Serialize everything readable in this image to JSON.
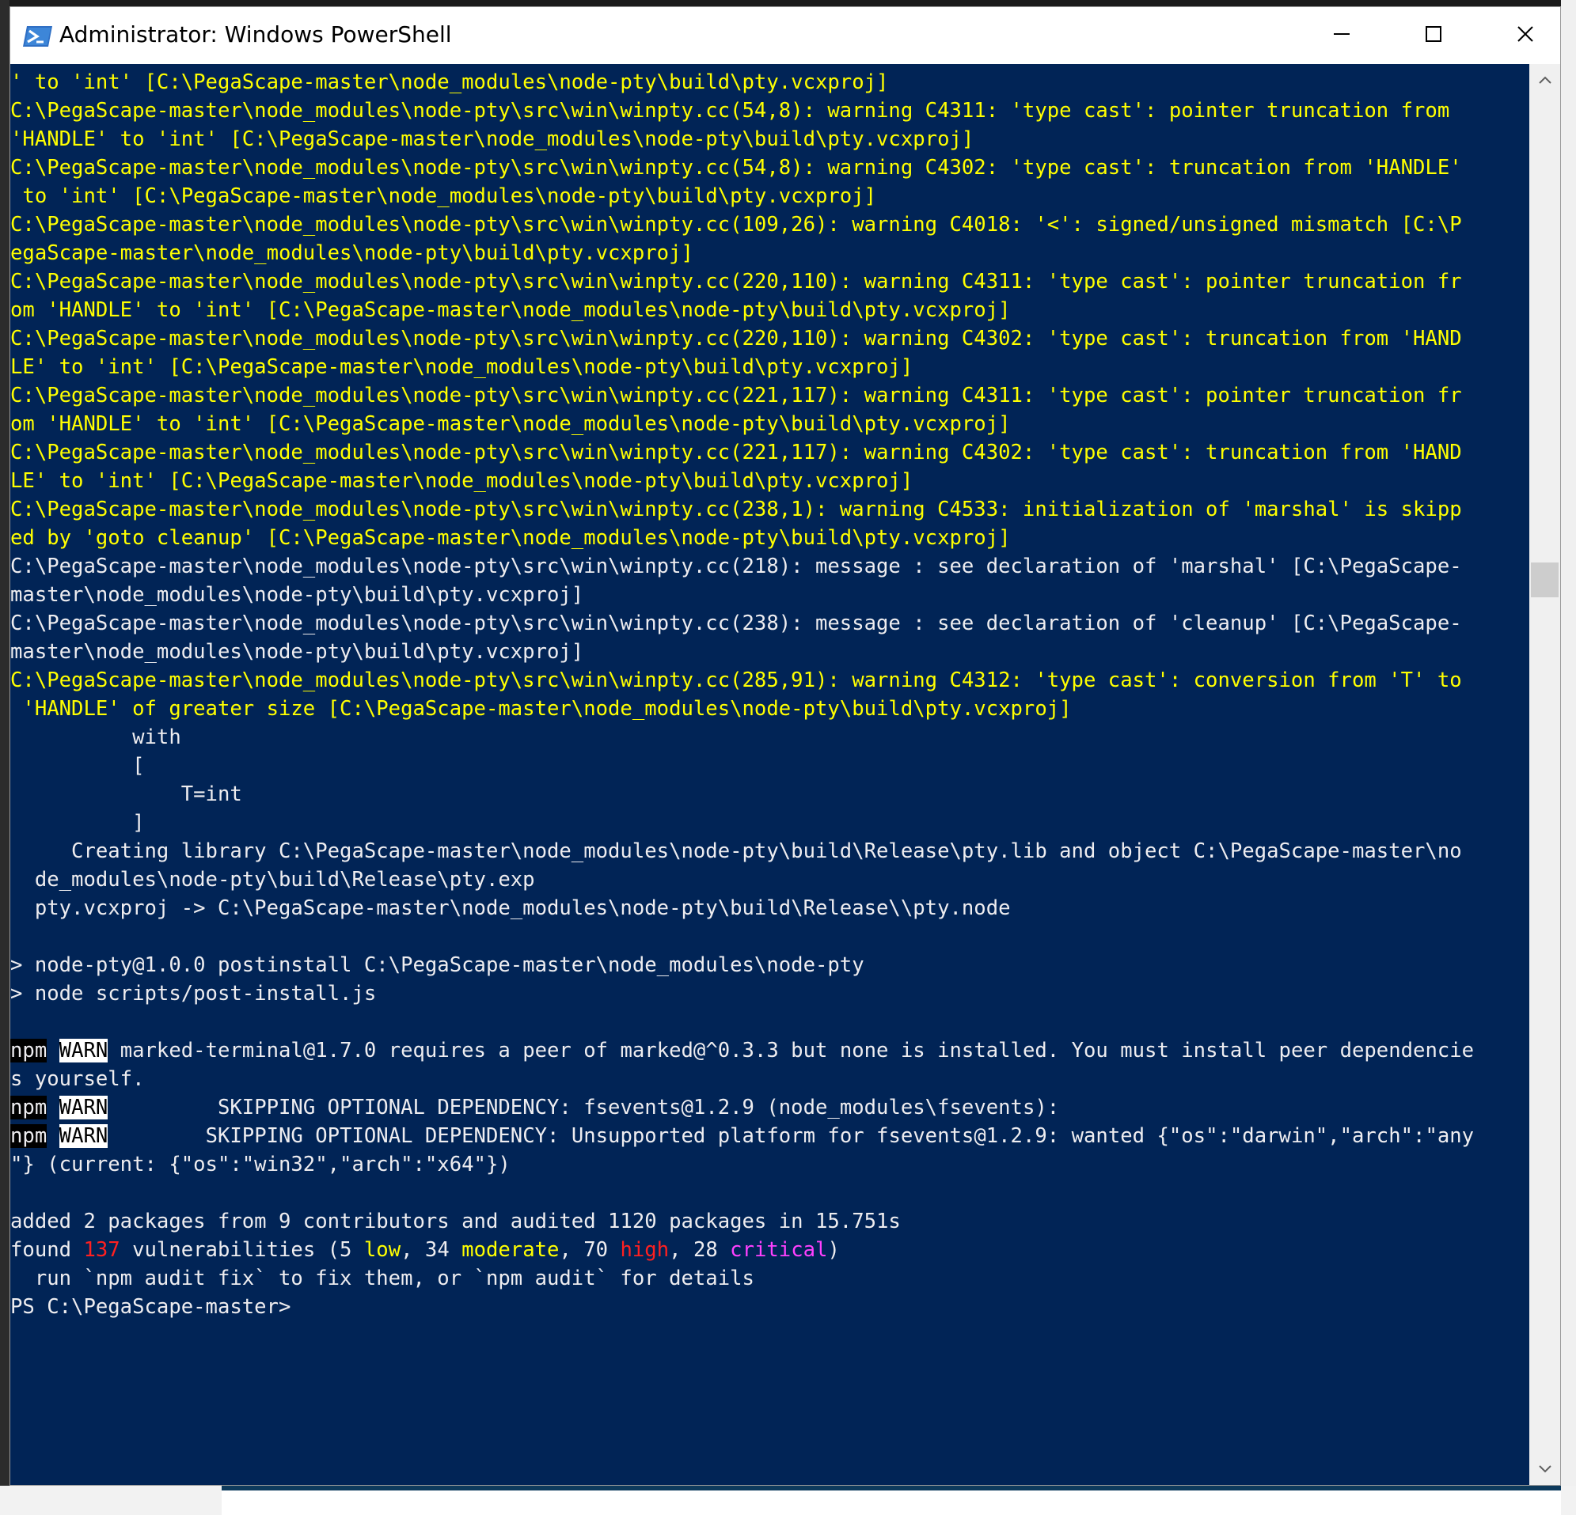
{
  "window": {
    "title": "Administrator: Windows PowerShell"
  },
  "colors": {
    "console_bg": "#012456",
    "warning_text": "#ffff00",
    "normal_text": "#eeedf0",
    "high": "#ff2020",
    "critical": "#ff40ff"
  },
  "icons": {
    "app": "powershell-icon",
    "minimize": "minimize-icon",
    "maximize": "maximize-icon",
    "close": "close-icon",
    "scroll_up": "chevron-up-icon",
    "scroll_down": "chevron-down-icon"
  },
  "console": {
    "lines": [
      {
        "t": "' to 'int' [C:\\PegaScape-master\\node_modules\\node-pty\\build\\pty.vcxproj]",
        "c": "y"
      },
      {
        "t": "C:\\PegaScape-master\\node_modules\\node-pty\\src\\win\\winpty.cc(54,8): warning C4311: 'type cast': pointer truncation from",
        "c": "y"
      },
      {
        "t": "'HANDLE' to 'int' [C:\\PegaScape-master\\node_modules\\node-pty\\build\\pty.vcxproj]",
        "c": "y"
      },
      {
        "t": "C:\\PegaScape-master\\node_modules\\node-pty\\src\\win\\winpty.cc(54,8): warning C4302: 'type cast': truncation from 'HANDLE'",
        "c": "y"
      },
      {
        "t": " to 'int' [C:\\PegaScape-master\\node_modules\\node-pty\\build\\pty.vcxproj]",
        "c": "y"
      },
      {
        "t": "C:\\PegaScape-master\\node_modules\\node-pty\\src\\win\\winpty.cc(109,26): warning C4018: '<': signed/unsigned mismatch [C:\\P",
        "c": "y"
      },
      {
        "t": "egaScape-master\\node_modules\\node-pty\\build\\pty.vcxproj]",
        "c": "y"
      },
      {
        "t": "C:\\PegaScape-master\\node_modules\\node-pty\\src\\win\\winpty.cc(220,110): warning C4311: 'type cast': pointer truncation fr",
        "c": "y"
      },
      {
        "t": "om 'HANDLE' to 'int' [C:\\PegaScape-master\\node_modules\\node-pty\\build\\pty.vcxproj]",
        "c": "y"
      },
      {
        "t": "C:\\PegaScape-master\\node_modules\\node-pty\\src\\win\\winpty.cc(220,110): warning C4302: 'type cast': truncation from 'HAND",
        "c": "y"
      },
      {
        "t": "LE' to 'int' [C:\\PegaScape-master\\node_modules\\node-pty\\build\\pty.vcxproj]",
        "c": "y"
      },
      {
        "t": "C:\\PegaScape-master\\node_modules\\node-pty\\src\\win\\winpty.cc(221,117): warning C4311: 'type cast': pointer truncation fr",
        "c": "y"
      },
      {
        "t": "om 'HANDLE' to 'int' [C:\\PegaScape-master\\node_modules\\node-pty\\build\\pty.vcxproj]",
        "c": "y"
      },
      {
        "t": "C:\\PegaScape-master\\node_modules\\node-pty\\src\\win\\winpty.cc(221,117): warning C4302: 'type cast': truncation from 'HAND",
        "c": "y"
      },
      {
        "t": "LE' to 'int' [C:\\PegaScape-master\\node_modules\\node-pty\\build\\pty.vcxproj]",
        "c": "y"
      },
      {
        "t": "C:\\PegaScape-master\\node_modules\\node-pty\\src\\win\\winpty.cc(238,1): warning C4533: initialization of 'marshal' is skipp",
        "c": "y"
      },
      {
        "t": "ed by 'goto cleanup' [C:\\PegaScape-master\\node_modules\\node-pty\\build\\pty.vcxproj]",
        "c": "y"
      },
      {
        "t": "C:\\PegaScape-master\\node_modules\\node-pty\\src\\win\\winpty.cc(218): message : see declaration of 'marshal' [C:\\PegaScape-",
        "c": "w"
      },
      {
        "t": "master\\node_modules\\node-pty\\build\\pty.vcxproj]",
        "c": "w"
      },
      {
        "t": "C:\\PegaScape-master\\node_modules\\node-pty\\src\\win\\winpty.cc(238): message : see declaration of 'cleanup' [C:\\PegaScape-",
        "c": "w"
      },
      {
        "t": "master\\node_modules\\node-pty\\build\\pty.vcxproj]",
        "c": "w"
      },
      {
        "t": "C:\\PegaScape-master\\node_modules\\node-pty\\src\\win\\winpty.cc(285,91): warning C4312: 'type cast': conversion from 'T' to",
        "c": "y"
      },
      {
        "t": " 'HANDLE' of greater size [C:\\PegaScape-master\\node_modules\\node-pty\\build\\pty.vcxproj]",
        "c": "y"
      },
      {
        "t": "          with",
        "c": "w"
      },
      {
        "t": "          [",
        "c": "w"
      },
      {
        "t": "              T=int",
        "c": "w"
      },
      {
        "t": "          ]",
        "c": "w"
      },
      {
        "t": "     Creating library C:\\PegaScape-master\\node_modules\\node-pty\\build\\Release\\pty.lib and object C:\\PegaScape-master\\no",
        "c": "w"
      },
      {
        "t": "  de_modules\\node-pty\\build\\Release\\pty.exp",
        "c": "w"
      },
      {
        "t": "  pty.vcxproj -> C:\\PegaScape-master\\node_modules\\node-pty\\build\\Release\\\\pty.node",
        "c": "w"
      },
      {
        "t": "",
        "c": "w"
      },
      {
        "t": "> node-pty@1.0.0 postinstall C:\\PegaScape-master\\node_modules\\node-pty",
        "c": "w"
      },
      {
        "t": "> node scripts/post-install.js",
        "c": "w"
      },
      {
        "t": "",
        "c": "w"
      },
      {
        "npm": "npm",
        "warn": "WARN",
        "t": " marked-terminal@1.7.0 requires a peer of marked@^0.3.3 but none is installed. You must install peer dependencie",
        "c": "w"
      },
      {
        "t": "s yourself.",
        "c": "w"
      },
      {
        "npm": "npm",
        "warn": "WARN",
        "t": "         SKIPPING OPTIONAL DEPENDENCY: fsevents@1.2.9 (node_modules\\fsevents):",
        "c": "w"
      },
      {
        "npm": "npm",
        "warn": "WARN",
        "t": "        SKIPPING OPTIONAL DEPENDENCY: Unsupported platform for fsevents@1.2.9: wanted {\"os\":\"darwin\",\"arch\":\"any",
        "c": "w"
      },
      {
        "t": "\"} (current: {\"os\":\"win32\",\"arch\":\"x64\"})",
        "c": "w"
      },
      {
        "t": "",
        "c": "w"
      },
      {
        "t": "added 2 packages from 9 contributors and audited 1120 packages in 15.751s",
        "c": "w"
      },
      {
        "segments": [
          {
            "t": "found ",
            "c": "w"
          },
          {
            "t": "137",
            "c": "red"
          },
          {
            "t": " vulnerabilities (5 ",
            "c": "w"
          },
          {
            "t": "low",
            "c": "yel"
          },
          {
            "t": ", 34 ",
            "c": "w"
          },
          {
            "t": "moderate",
            "c": "yel"
          },
          {
            "t": ", 70 ",
            "c": "w"
          },
          {
            "t": "high",
            "c": "red"
          },
          {
            "t": ", 28 ",
            "c": "w"
          },
          {
            "t": "critical",
            "c": "mag"
          },
          {
            "t": ")",
            "c": "w"
          }
        ]
      },
      {
        "t": "  run `npm audit fix` to fix them, or `npm audit` for details",
        "c": "w"
      },
      {
        "t": "PS C:\\PegaScape-master>",
        "c": "w"
      }
    ]
  }
}
